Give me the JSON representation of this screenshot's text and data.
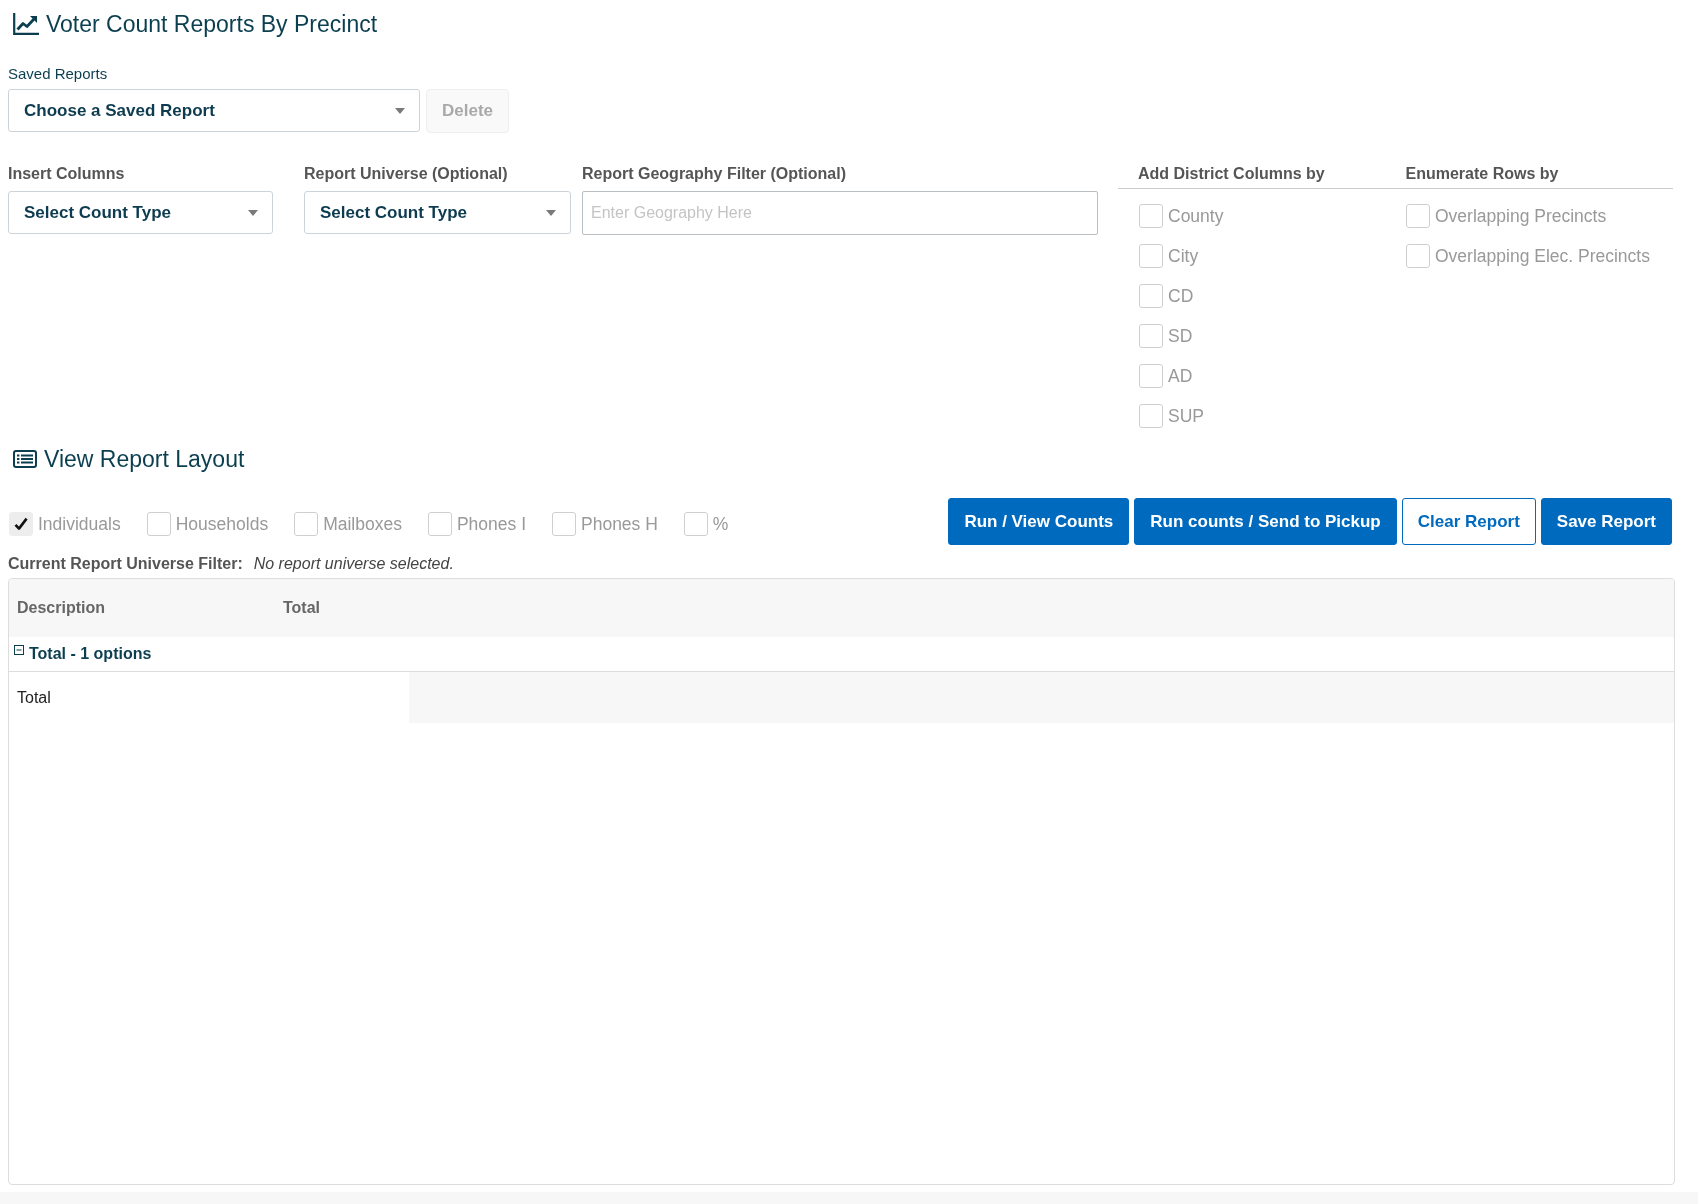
{
  "page": {
    "title": "Voter Count Reports By Precinct"
  },
  "saved_reports": {
    "label": "Saved Reports",
    "dropdown": {
      "value": "Choose a Saved Report"
    },
    "delete_button": {
      "label": "Delete",
      "disabled": true
    }
  },
  "filters": [
    {
      "kind": "select",
      "label": "Insert Columns",
      "value": "Select Count Type"
    },
    {
      "kind": "select",
      "label": "Report Universe (Optional)",
      "value": "Select Count Type"
    },
    {
      "kind": "text",
      "label": "Report Geography Filter (Optional)",
      "placeholder": "Enter Geography Here"
    }
  ],
  "option_groups": [
    {
      "heading": "Add District Columns by",
      "options": [
        {
          "label": "County",
          "checked": false
        },
        {
          "label": "City",
          "checked": false
        },
        {
          "label": "CD",
          "checked": false
        },
        {
          "label": "SD",
          "checked": false
        },
        {
          "label": "AD",
          "checked": false
        },
        {
          "label": "SUP",
          "checked": false
        }
      ]
    },
    {
      "heading": "Enumerate Rows by",
      "options": [
        {
          "label": "Overlapping Precincts",
          "checked": false
        },
        {
          "label": "Overlapping Elec. Precincts",
          "checked": false
        }
      ]
    }
  ],
  "report_layout": {
    "title": "View Report Layout",
    "measures": [
      {
        "label": "Individuals",
        "checked": true
      },
      {
        "label": "Households",
        "checked": false
      },
      {
        "label": "Mailboxes",
        "checked": false
      },
      {
        "label": "Phones I",
        "checked": false
      },
      {
        "label": "Phones H",
        "checked": false
      },
      {
        "label": "%",
        "checked": false
      }
    ],
    "buttons": [
      {
        "label": "Run / View Counts",
        "kind": "primary"
      },
      {
        "label": "Run counts / Send to Pickup",
        "kind": "primary"
      },
      {
        "label": "Clear Report",
        "kind": "outline"
      },
      {
        "label": "Save Report",
        "kind": "primary"
      }
    ],
    "universe_filter": {
      "label": "Current Report Universe Filter:",
      "value": "No report universe selected."
    }
  },
  "table": {
    "columns": [
      "Description",
      "Total"
    ],
    "groups": [
      {
        "label": "Total - 1 options",
        "expanded": true,
        "rows": [
          {
            "description": "Total"
          }
        ]
      }
    ]
  }
}
